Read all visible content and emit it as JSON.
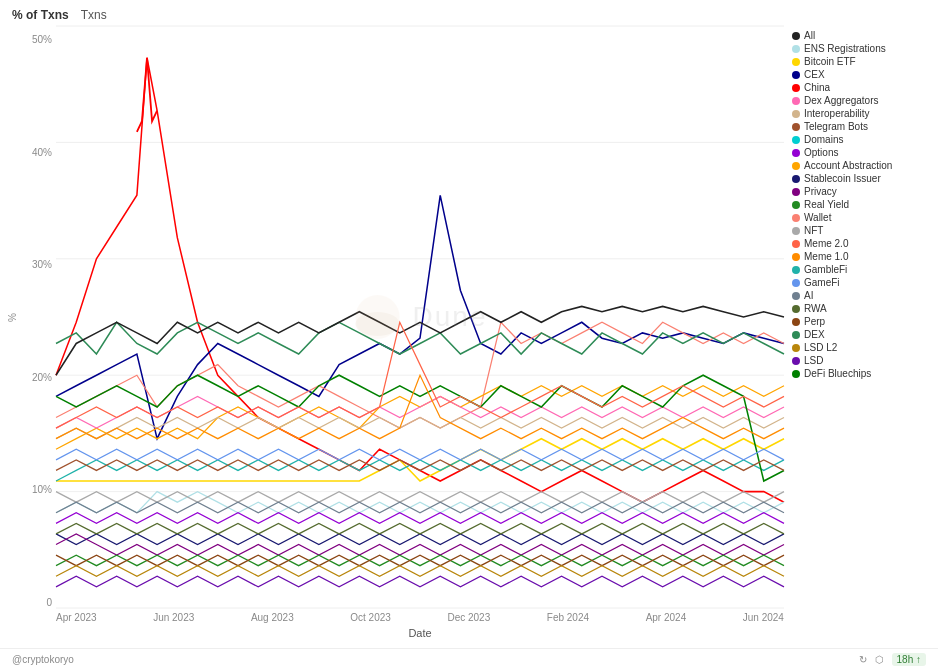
{
  "header": {
    "tabs": [
      "% of Txns",
      "Txns"
    ],
    "active_tab": "% of Txns"
  },
  "chart": {
    "y_axis": {
      "labels": [
        "50%",
        "40%",
        "30%",
        "20%",
        "10%",
        "0"
      ],
      "title": "%"
    },
    "x_axis": {
      "labels": [
        "Apr 2023",
        "Jun 2023",
        "Aug 2023",
        "Oct 2023",
        "Dec 2023",
        "Feb 2024",
        "Apr 2024",
        "Jun 2024"
      ],
      "title": "Date"
    }
  },
  "legend": {
    "items": [
      {
        "label": "All",
        "color": "#222222"
      },
      {
        "label": "ENS Registrations",
        "color": "#b0e0e6"
      },
      {
        "label": "Bitcoin ETF",
        "color": "#ffd700"
      },
      {
        "label": "CEX",
        "color": "#00008b"
      },
      {
        "label": "China",
        "color": "#ff0000"
      },
      {
        "label": "Dex Aggregators",
        "color": "#ff69b4"
      },
      {
        "label": "Interoperability",
        "color": "#d2b48c"
      },
      {
        "label": "Telegram Bots",
        "color": "#a0522d"
      },
      {
        "label": "Domains",
        "color": "#00ced1"
      },
      {
        "label": "Options",
        "color": "#9400d3"
      },
      {
        "label": "Account Abstraction",
        "color": "#ffa500"
      },
      {
        "label": "Stablecoin Issuer",
        "color": "#191970"
      },
      {
        "label": "Privacy",
        "color": "#800080"
      },
      {
        "label": "Real Yield",
        "color": "#228b22"
      },
      {
        "label": "Wallet",
        "color": "#fa8072"
      },
      {
        "label": "NFT",
        "color": "#a9a9a9"
      },
      {
        "label": "Meme 2.0",
        "color": "#ff6347"
      },
      {
        "label": "Meme 1.0",
        "color": "#ff8c00"
      },
      {
        "label": "GambleFi",
        "color": "#20b2aa"
      },
      {
        "label": "GameFi",
        "color": "#6495ed"
      },
      {
        "label": "AI",
        "color": "#708090"
      },
      {
        "label": "RWA",
        "color": "#556b2f"
      },
      {
        "label": "Perp",
        "color": "#8b4513"
      },
      {
        "label": "DEX",
        "color": "#2e8b57"
      },
      {
        "label": "LSD L2",
        "color": "#b8860b"
      },
      {
        "label": "LSD",
        "color": "#6a0dad"
      },
      {
        "label": "DeFi Bluechips",
        "color": "#008000"
      }
    ]
  },
  "watermark": {
    "text": "Dune"
  },
  "footer": {
    "attribution": "@cryptokoryo",
    "badge": "18h ↑"
  }
}
